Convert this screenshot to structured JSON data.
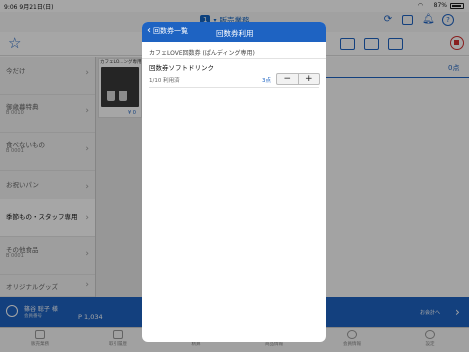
{
  "status_bar": {
    "time": "9:06 9月21日(日)",
    "battery_pct": "87%",
    "wifi_icon": "wifi-icon"
  },
  "header": {
    "register_number": "1",
    "title": "販売業務",
    "icons": [
      "refresh-icon",
      "sidebar-toggle-icon",
      "bell-icon",
      "help-icon"
    ]
  },
  "toolbar": {
    "icons": [
      "star-icon",
      "register-icon",
      "bag-icon",
      "card-icon",
      "stop-icon"
    ]
  },
  "sidebar": {
    "items": [
      {
        "label": "今だけ",
        "code": ""
      },
      {
        "label": "御歳暮特典",
        "code": "B 0010"
      },
      {
        "label": "食べないもの",
        "code": "B 0001"
      },
      {
        "label": "お祝いパン",
        "code": ""
      },
      {
        "label": "季節もの・スタッフ専用",
        "code": ""
      },
      {
        "label": "その他食品",
        "code": "B 0001"
      },
      {
        "label": "オリジナルグッズ",
        "code": ""
      }
    ],
    "active_index": 4
  },
  "product": {
    "name": "カフェLO...ング専用)",
    "price": "¥ 0"
  },
  "order_panel": {
    "total": "0点"
  },
  "customer": {
    "name": "篠谷 聡子 様",
    "sub": "会員番号",
    "points": "P 1,034"
  },
  "checkout": {
    "label": "お会計へ"
  },
  "tabbar": {
    "tabs": [
      "販売業務",
      "取引履歴",
      "精算",
      "商品情報",
      "会員情報",
      "設定"
    ]
  },
  "modal": {
    "back_label": "回数券一覧",
    "title": "回数券利用",
    "ticket_name": "カフェLOVE回数券 (ぱんディング専用)",
    "section_title": "回数券ソフトドリンク",
    "usage": "1/10 利用済",
    "points": "3点",
    "minus": "−",
    "plus": "+"
  }
}
